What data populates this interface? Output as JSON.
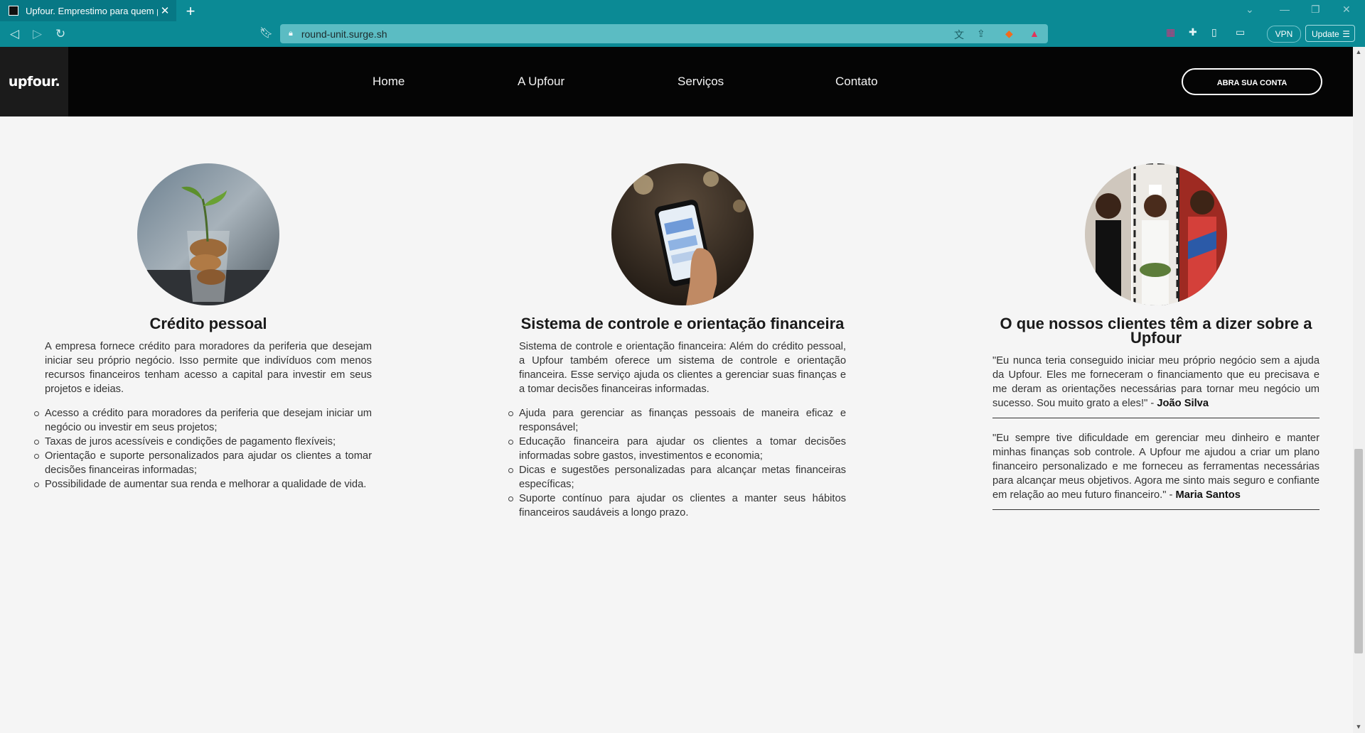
{
  "browser": {
    "tab_title": "Upfour. Emprestimo para quem p",
    "tab_close": "✕",
    "new_tab": "+",
    "url": "round-unit.surge.sh",
    "vpn_label": "VPN",
    "update_label": "Update"
  },
  "header": {
    "logo": "upfour.",
    "nav": [
      "Home",
      "A Upfour",
      "Serviços",
      "Contato"
    ],
    "cta": "ABRA SUA CONTA"
  },
  "columns": {
    "credito": {
      "title": "Crédito pessoal",
      "intro": "A empresa fornece crédito para moradores da periferia que desejam iniciar seu próprio negócio. Isso permite que indivíduos com menos recursos financeiros tenham acesso a capital para investir em seus projetos e ideias.",
      "items": [
        "Acesso a crédito para moradores da periferia que desejam iniciar um negócio ou investir em seus projetos;",
        "Taxas de juros acessíveis e condições de pagamento flexíveis;",
        "Orientação e suporte personalizados para ajudar os clientes a tomar decisões financeiras informadas;",
        "Possibilidade de aumentar sua renda e melhorar a qualidade de vida."
      ]
    },
    "sistema": {
      "title": "Sistema de controle e orientação financeira",
      "intro": "Sistema de controle e orientação financeira: Além do crédito pessoal, a Upfour também oferece um sistema de controle e orientação financeira. Esse serviço ajuda os clientes a gerenciar suas finanças e a tomar decisões financeiras informadas.",
      "items": [
        "Ajuda para gerenciar as finanças pessoais de maneira eficaz e responsável;",
        "Educação financeira para ajudar os clientes a tomar decisões informadas sobre gastos, investimentos e economia;",
        "Dicas e sugestões personalizadas para alcançar metas financeiras específicas;",
        "Suporte contínuo para ajudar os clientes a manter seus hábitos financeiros saudáveis a longo prazo."
      ]
    },
    "depoimentos": {
      "title": "O que nossos clientes têm a dizer sobre a Upfour",
      "quotes": [
        {
          "text": "\"Eu nunca teria conseguido iniciar meu próprio negócio sem a ajuda da Upfour. Eles me forneceram o financiamento que eu precisava e me deram as orientações necessárias para tornar meu negócio um sucesso. Sou muito grato a eles!\" - ",
          "author": "João Silva"
        },
        {
          "text": "\"Eu sempre tive dificuldade em gerenciar meu dinheiro e manter minhas finanças sob controle. A Upfour me ajudou a criar um plano financeiro personalizado e me forneceu as ferramentas necessárias para alcançar meus objetivos. Agora me sinto mais seguro e confiante em relação ao meu futuro financeiro.\" - ",
          "author": "Maria Santos"
        }
      ]
    }
  }
}
